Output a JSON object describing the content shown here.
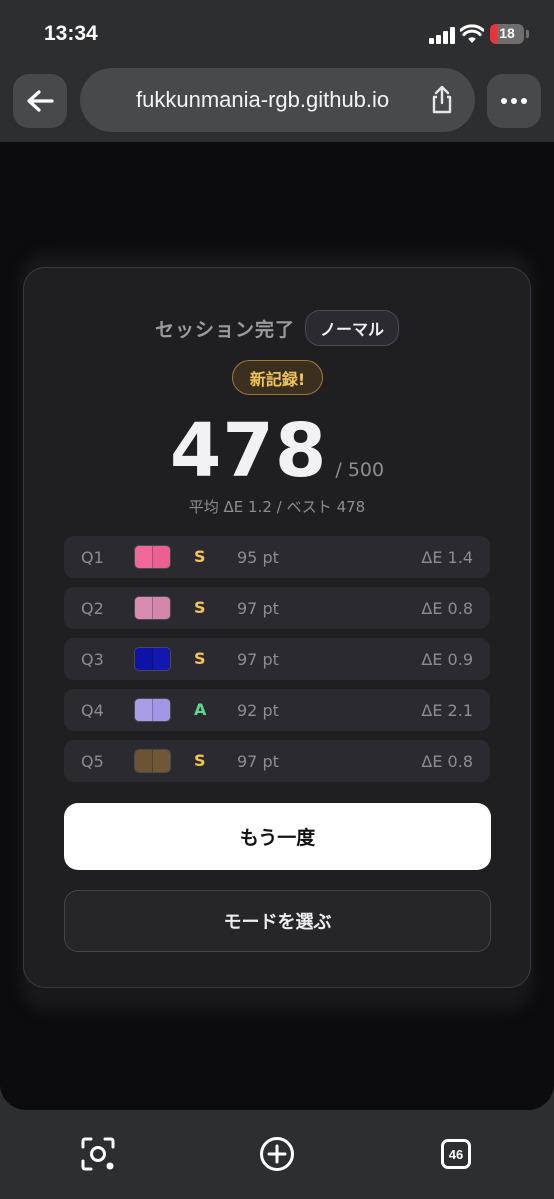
{
  "status_bar": {
    "time": "13:34",
    "battery": "18"
  },
  "browser": {
    "url": "fukkunmania-rgb.github.io"
  },
  "result": {
    "title": "セッション完了",
    "mode": "ノーマル",
    "badge": "新記録!",
    "score": "478",
    "score_max": "/ 500",
    "summary": "平均 ΔE 1.2 / ベスト 478",
    "rows": [
      {
        "q": "Q1",
        "grade": "S",
        "points": "95 pt",
        "delta": "ΔE 1.4",
        "colors": [
          "#f0679a",
          "#ec5f92"
        ],
        "grade_color": "#f5c451"
      },
      {
        "q": "Q2",
        "grade": "S",
        "points": "97 pt",
        "delta": "ΔE 0.8",
        "colors": [
          "#d98bb0",
          "#d487ab"
        ],
        "grade_color": "#f5c451"
      },
      {
        "q": "Q3",
        "grade": "S",
        "points": "97 pt",
        "delta": "ΔE 0.9",
        "colors": [
          "#0f12a8",
          "#1416b2"
        ],
        "grade_color": "#f5c451"
      },
      {
        "q": "Q4",
        "grade": "A",
        "points": "92 pt",
        "delta": "ΔE 2.1",
        "colors": [
          "#a99de8",
          "#a296e6"
        ],
        "grade_color": "#5fd98a"
      },
      {
        "q": "Q5",
        "grade": "S",
        "points": "97 pt",
        "delta": "ΔE 0.8",
        "colors": [
          "#6b5335",
          "#705738"
        ],
        "grade_color": "#f5c451"
      }
    ],
    "retry_label": "もう一度",
    "choose_mode_label": "モードを選ぶ"
  },
  "toolbar": {
    "tabs_count": "46"
  },
  "icons": [
    "back-arrow-icon",
    "share-icon",
    "more-icon",
    "visual-search-icon",
    "new-tab-icon",
    "tabs-icon",
    "signal-icon",
    "wifi-icon",
    "battery-icon"
  ]
}
